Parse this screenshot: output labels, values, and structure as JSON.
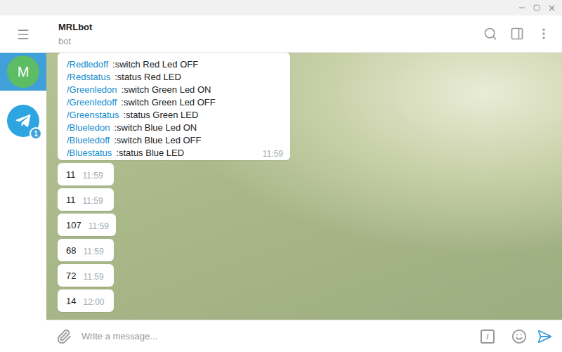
{
  "sidebar": {
    "items": [
      {
        "kind": "chat",
        "label": "M",
        "badge": "",
        "selected": true,
        "color": "#5cbd65"
      },
      {
        "kind": "telegram",
        "label": "",
        "badge": "1",
        "selected": false,
        "color": "#2da5e1"
      }
    ]
  },
  "chat": {
    "title": "MRLbot",
    "subtitle": "bot"
  },
  "messages": [
    {
      "kind": "commands",
      "time": "11:59",
      "text": "",
      "commands": [
        {
          "command": "/Redledoff",
          "description": ":switch Red Led OFF"
        },
        {
          "command": "/Redstatus",
          "description": ":status Red LED"
        },
        {
          "command": "/Greenledon",
          "description": ":switch Green Led ON"
        },
        {
          "command": "/Greenledoff",
          "description": ":switch Green Led OFF"
        },
        {
          "command": "/Greenstatus",
          "description": ":status Green LED"
        },
        {
          "command": "/Blueledon",
          "description": ":switch Blue Led ON"
        },
        {
          "command": "/Blueledoff",
          "description": ":switch Blue Led OFF"
        },
        {
          "command": "/Bluestatus",
          "description": ":status Blue LED"
        }
      ]
    },
    {
      "kind": "text",
      "text": "11",
      "time": "11:59",
      "commands": []
    },
    {
      "kind": "text",
      "text": "11",
      "time": "11:59",
      "commands": []
    },
    {
      "kind": "text",
      "text": "107",
      "time": "11:59",
      "commands": []
    },
    {
      "kind": "text",
      "text": "68",
      "time": "11:59",
      "commands": []
    },
    {
      "kind": "text",
      "text": "72",
      "time": "11:59",
      "commands": []
    },
    {
      "kind": "text",
      "text": "14",
      "time": "12:00",
      "commands": []
    }
  ],
  "composer": {
    "placeholder": "Write a message...",
    "command_button": "/"
  }
}
